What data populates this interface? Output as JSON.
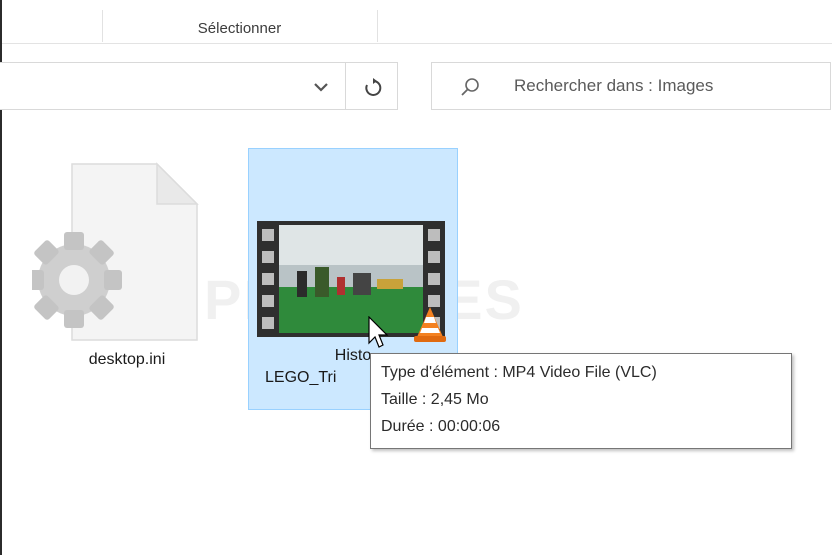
{
  "ribbon": {
    "group_label": "Sélectionner"
  },
  "navbar": {
    "dropdown_icon": "chevron-down-icon",
    "refresh_icon": "refresh-icon",
    "search": {
      "icon": "search-icon",
      "placeholder": "Rechercher dans : Images"
    }
  },
  "files": [
    {
      "name": "desktop.ini",
      "icon": "settings-file-icon"
    },
    {
      "name_line1": "Histo",
      "name_line2": "LEGO_Tri",
      "icon": "video-file-icon",
      "overlay_icon": "vlc-cone-icon",
      "selected": true
    }
  ],
  "watermark": "PRATUCES",
  "tooltip": {
    "type": "Type d'élément : MP4 Video File (VLC)",
    "size": "Taille : 2,45 Mo",
    "duration": "Durée : 00:00:06"
  },
  "colors": {
    "selection_bg": "#cce8ff",
    "selection_border": "#99d1ff",
    "vlc_orange": "#f48120"
  }
}
